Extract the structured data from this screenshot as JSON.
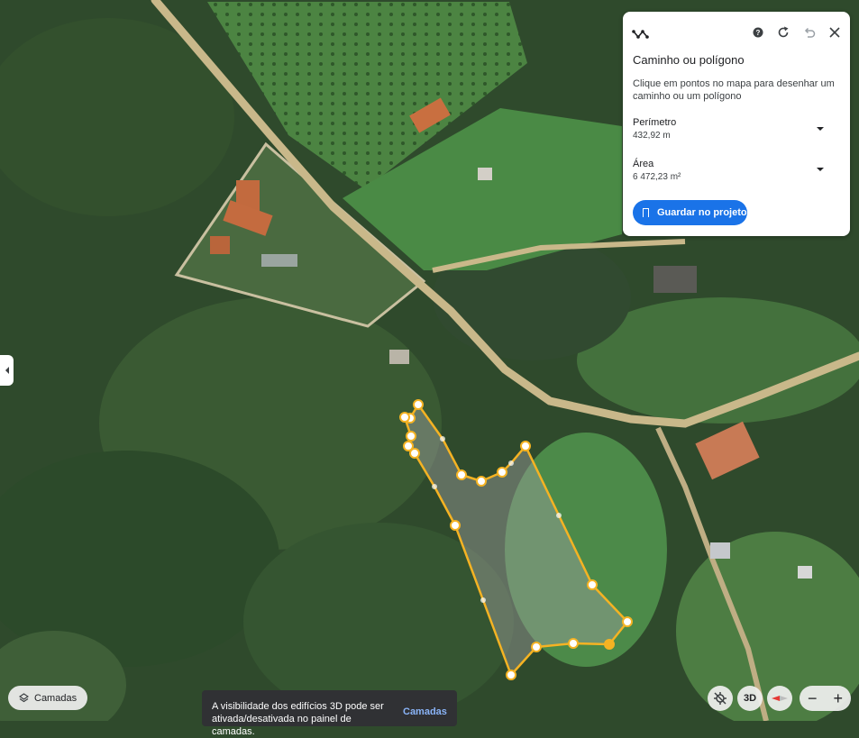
{
  "panel": {
    "title": "Caminho ou polígono",
    "description": "Clique em pontos no mapa para desenhar um caminho ou um polígono",
    "perimeter_label": "Perímetro",
    "perimeter_value": "432,92 m",
    "area_label": "Área",
    "area_value": "6 472,23 m²",
    "save_label": "Guardar no projeto",
    "icons": [
      "ruler-icon",
      "help-icon",
      "reset-icon",
      "undo-icon",
      "close-icon"
    ]
  },
  "bottom": {
    "layers_label": "Camadas",
    "toast_message": "A visibilidade dos edifícios 3D pode ser ativada/desativada no painel de camadas.",
    "toast_action": "Camadas",
    "view_3d_label": "3D",
    "zoom_out": "−",
    "zoom_in": "+"
  },
  "colors": {
    "accent": "#1a73e8",
    "polygon_stroke": "#f5b323",
    "polygon_fill": "rgba(160,160,160,0.45)"
  }
}
